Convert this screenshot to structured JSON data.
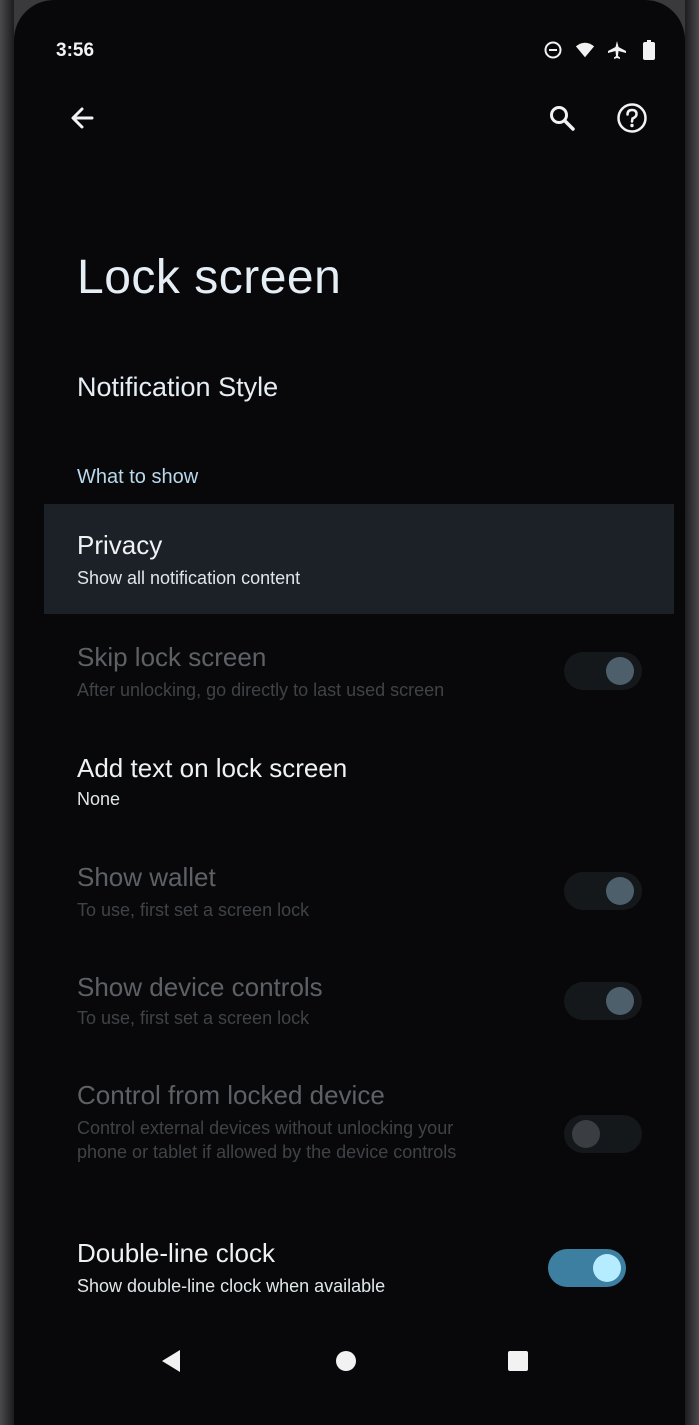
{
  "status_bar": {
    "time": "3:56",
    "icons": [
      "do-not-disturb-icon",
      "wifi-icon",
      "airplane-icon",
      "battery-icon"
    ]
  },
  "app_bar": {
    "back_icon": "arrow-left-icon",
    "search_icon": "search-icon",
    "help_icon": "help-circle-icon"
  },
  "page": {
    "title": "Lock screen",
    "notification_style": "Notification Style",
    "section_what_to_show": "What to show"
  },
  "items": [
    {
      "title": "Privacy",
      "subtitle": "Show all notification content"
    },
    {
      "title": "Skip lock screen",
      "subtitle": "After unlocking, go directly to last used screen",
      "toggle": false,
      "enabled": false
    },
    {
      "title": "Add text on lock screen",
      "subtitle": "None"
    },
    {
      "title": "Show wallet",
      "subtitle": "To use, first set a screen lock",
      "toggle": false,
      "enabled": false
    },
    {
      "title": "Show device controls",
      "subtitle": "To use, first set a screen lock",
      "toggle": false,
      "enabled": false
    },
    {
      "title": "Control from locked device",
      "subtitle_line1": "Control external devices without unlocking your",
      "subtitle_line2": "phone or tablet if allowed by the device controls",
      "toggle": false,
      "enabled": false
    },
    {
      "title": "Double-line clock",
      "subtitle": "Show double-line clock when available",
      "toggle": true,
      "enabled": true
    }
  ],
  "nav_bar": {
    "back_icon": "triangle-back-icon",
    "home_icon": "circle-home-icon",
    "recents_icon": "square-recents-icon"
  },
  "colors": {
    "background": "#08080a",
    "accent": "#3d7fa1",
    "section_header": "#b9d8ec",
    "highlight_row": "#1b2126"
  }
}
